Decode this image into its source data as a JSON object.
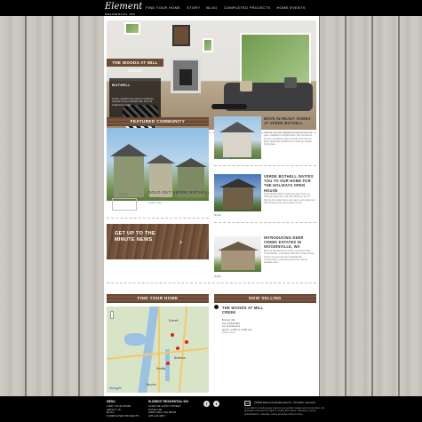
{
  "header": {
    "logo": "Element",
    "logo_sub": "RESIDENTIAL INC",
    "nav": [
      "FIND YOUR HOME",
      "STORY",
      "BLOG",
      "COMPLETED PROJECTS",
      "HOME EVENTS"
    ]
  },
  "hero": {
    "title": "THE WOODS AT MILL CREEK",
    "caption_heading": "BOTHELL",
    "caption_text": "A quiet, wooded community of craftsman-inspired homes in Bothell, WA. Tour the model home today."
  },
  "featured": {
    "heading": "FEATURED COMMUNITY",
    "logo_text": "VERDE",
    "logo_sub": "BOTHELL",
    "title": "SOLD OUT VERDE BOTHELL",
    "subtitle": "Sold Out",
    "link": "Learn more"
  },
  "news": [
    {
      "title": "MOVE IN READY HOMES AT VERDE BOTHELL",
      "body": "Verde is a premier collection of luxury homes in a quiet, established neighborhood, with convenient access to shopping, parks and top rated schools. Every detail was considered to create an elegant living space.",
      "more": "Continue reading"
    },
    {
      "title": "VERDE BOTHELL INVITES YOU TO OUR HOME FOR THE HOLIDAYS OPEN HOUSE",
      "body": "Verde Bothell will be hosting an open house on Saturday December 12th and 13th from 12 to 5. Stop by the model home and enjoy a cozy afternoon with refreshments and a chance to win.",
      "more": "MORE"
    },
    {
      "title": "INTRODUCING DEER CREEK ESTATES IN WOODINVILLE, WA",
      "body": "Element Residential is proud to announce Deer Creek Estates, a boutique collection of three luxury homes on generous lots in Woodinville. Construction is underway and homes will be available soon.",
      "more": "MORE"
    }
  ],
  "signup": {
    "text": "GET UP TO THE MINUTE NEWS",
    "arrow": "›"
  },
  "find_home": {
    "heading": "FIND YOUR HOME",
    "labels": [
      "Everett",
      "Bellevue",
      "Seattle",
      "Tacoma"
    ],
    "map_brand": "Google"
  },
  "now_selling": {
    "heading": "NOW SELLING",
    "title": "THE WOODS AT MILL CREEK",
    "lines": [
      "Bothell, WA",
      "From $ 849,990",
      "4 to 5 bedrooms",
      "approx. 2,900 to 3,450 sq ft"
    ],
    "link": "Learn more"
  },
  "footer": {
    "menu_heading": "MENU",
    "menu": [
      "FIND YOUR HOME",
      "ABOUT US",
      "BLOG",
      "COMPLETED PROJECTS"
    ],
    "company_heading": "ELEMENT RESIDENTIAL INC.",
    "address": [
      "11332 NE 120TH STREET",
      "SUITE 100",
      "KIRKLAND, WA 98034",
      "425.123.4567"
    ],
    "social": [
      "f",
      "t"
    ],
    "ehl": "EHO",
    "copyright": "©2025 Element Residential Inc. All rights reserved",
    "legal": "In an effort to continuously improve our product design and construction, the developer reserves the right to modify floor plans, elevations, prices, specifications, materials, colors and area without notice."
  }
}
